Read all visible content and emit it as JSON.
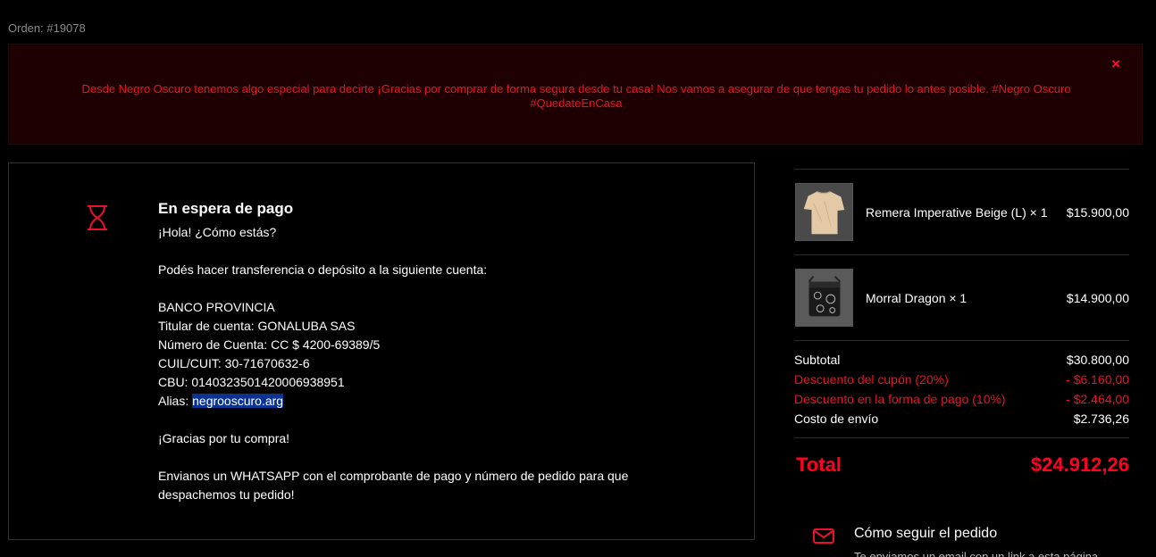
{
  "order": {
    "label": "Orden: #19078"
  },
  "alert": {
    "message": "Desde Negro Oscuro tenemos algo especial para decirte ¡Gracias por comprar de forma segura desde tu casa! Nos vamos a asegurar de que tengas tu pedido lo antes posible. #Negro Oscuro #QuedateEnCasa",
    "close": "×"
  },
  "status": {
    "title": "En espera de pago",
    "greeting": "¡Hola! ¿Cómo estás?",
    "instructions": "Podés hacer transferencia o depósito a la siguiente cuenta:",
    "bank": "BANCO PROVINCIA",
    "holder": "Titular de cuenta: GONALUBA SAS",
    "account": "Número de Cuenta: CC $ 4200-69389/5",
    "cuit": "CUIL/CUIT: 30-71670632-6",
    "cbu": "CBU: 0140323501420006938951",
    "alias_label": "Alias: ",
    "alias_value": "negrooscuro.arg",
    "thanks": "¡Gracias por tu compra!",
    "whatsapp_line1": "Envianos un WHATSAPP con el comprobante de pago y número de pedido para que",
    "whatsapp_line2": "despachemos tu pedido!"
  },
  "summary": {
    "items": [
      {
        "name": "Remera Imperative Beige (L) × 1",
        "price": "$15.900,00",
        "icon": "beige-tshirt-thumbnail"
      },
      {
        "name": "Morral Dragon × 1",
        "price": "$14.900,00",
        "icon": "black-bag-thumbnail"
      }
    ],
    "subtotal_label": "Subtotal",
    "subtotal_value": "$30.800,00",
    "coupon_label": "Descuento del cupón (20%)",
    "coupon_value": "- $6.160,00",
    "payment_discount_label": "Descuento en la forma de pago (10%)",
    "payment_discount_value": "- $2.464,00",
    "shipping_label": "Costo de envío",
    "shipping_value": "$2.736,26",
    "total_label": "Total",
    "total_value": "$24.912,26"
  },
  "follow": {
    "title": "Cómo seguir el pedido",
    "subtitle": "Te enviamos un email con un link a esta página"
  },
  "colors": {
    "accent": "#e8122a",
    "alert_bg": "#1e0003",
    "highlight": "#0a3394"
  }
}
